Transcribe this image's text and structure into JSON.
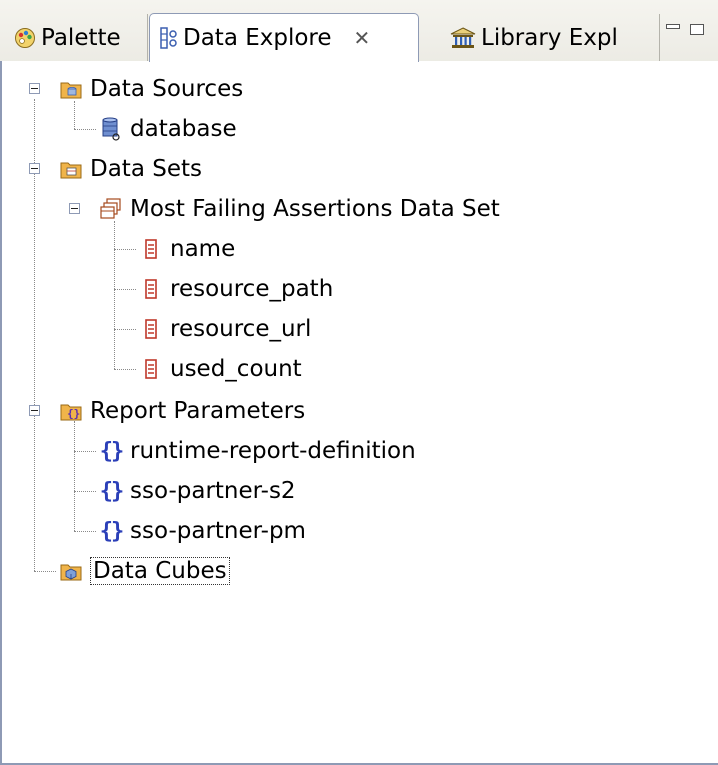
{
  "tabs": {
    "palette": {
      "label": "Palette",
      "icon": "palette-icon"
    },
    "data_explorer": {
      "label": "Data Explore",
      "icon": "data-explorer-icon",
      "close": "✕"
    },
    "library_explorer": {
      "label": "Library Expl",
      "icon": "library-icon"
    }
  },
  "tree": {
    "data_sources": {
      "label": "Data Sources",
      "children": [
        {
          "label": "database",
          "icon": "database-icon"
        }
      ]
    },
    "data_sets": {
      "label": "Data Sets",
      "dataset": {
        "label": "Most Failing Assertions Data Set",
        "columns": [
          "name",
          "resource_path",
          "resource_url",
          "used_count"
        ]
      }
    },
    "report_parameters": {
      "label": "Report Parameters",
      "params": [
        "runtime-report-definition",
        "sso-partner-s2",
        "sso-partner-pm"
      ],
      "param_glyph": "{}"
    },
    "data_cubes": {
      "label": "Data Cubes"
    }
  },
  "colors": {
    "tab_border": "#8e9ab5",
    "folder": "#e8a33a",
    "column_icon": "#c0392b",
    "param_icon": "#2b3fb8"
  }
}
